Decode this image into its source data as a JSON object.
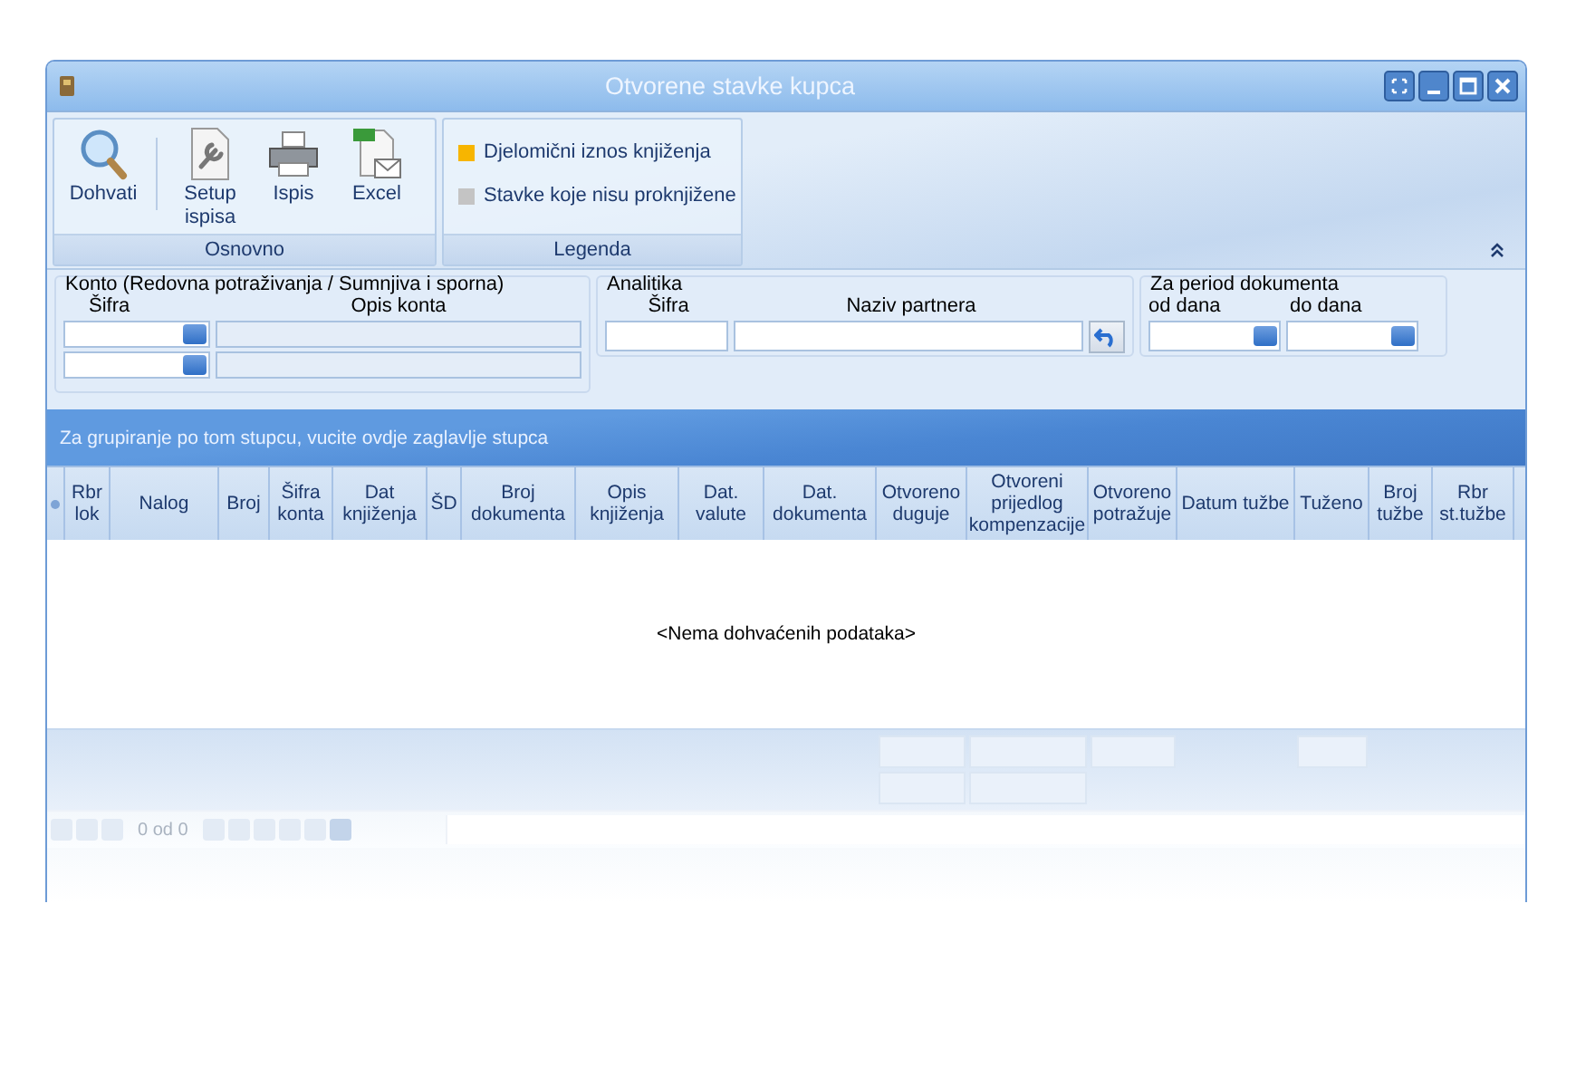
{
  "window": {
    "title": "Otvorene stavke kupca"
  },
  "ribbon": {
    "groups": [
      {
        "kind": "buttons",
        "label": "Osnovno",
        "buttons": [
          {
            "label": "Dohvati",
            "kind": "fetch"
          },
          {
            "label": "Setup ispisa",
            "kind": "setup"
          },
          {
            "label": "Ispis",
            "kind": "print"
          },
          {
            "label": "Excel",
            "kind": "export"
          }
        ]
      },
      {
        "kind": "legend",
        "label": "Legenda",
        "items": [
          {
            "label": "Djelomični iznos knjiženja",
            "color": "#f7b500"
          },
          {
            "label": "Stavke koje nisu proknjižene",
            "color": "#c4c4c4"
          }
        ]
      }
    ]
  },
  "filters": {
    "konto": {
      "title": "Konto (Redovna potraživanja / Sumnjiva i sporna)",
      "code_label": "Šifra",
      "description_label": "Opis konta"
    },
    "analitika": {
      "title": "Analitika",
      "code_label": "Šifra",
      "name_label": "Naziv partnera"
    },
    "period": {
      "title": "Za period dokumenta",
      "from_label": "od dana",
      "to_label": "do dana"
    }
  },
  "grid": {
    "group_panel_hint": "Za grupiranje po tom stupcu, vucite ovdje zaglavlje stupca",
    "columns": [
      "Rbr lok",
      "Nalog",
      "Broj",
      "Šifra konta",
      "Dat knjiženja",
      "ŠD",
      "Broj dokumenta",
      "Opis knjiženja",
      "Dat. valute",
      "Dat. dokumenta",
      "Otvoreno duguje",
      "Otvoreni prijedlog kompenzacije",
      "Otvoreno potražuje",
      "Datum tužbe",
      "Tuženo",
      "Broj tužbe",
      "Rbr st.tužbe"
    ],
    "empty_text": "<Nema dohvaćenih podataka>",
    "navigator": {
      "position": "0 od 0"
    }
  }
}
